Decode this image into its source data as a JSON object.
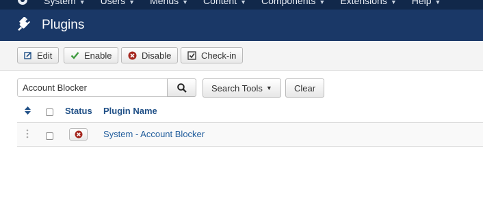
{
  "top_nav": {
    "items": [
      {
        "label": "System"
      },
      {
        "label": "Users"
      },
      {
        "label": "Menus"
      },
      {
        "label": "Content"
      },
      {
        "label": "Components"
      },
      {
        "label": "Extensions"
      },
      {
        "label": "Help"
      }
    ]
  },
  "header": {
    "title": "Plugins"
  },
  "toolbar": {
    "edit_label": "Edit",
    "enable_label": "Enable",
    "disable_label": "Disable",
    "checkin_label": "Check-in"
  },
  "search": {
    "value": "Account Blocker",
    "search_tools_label": "Search Tools",
    "clear_label": "Clear"
  },
  "table": {
    "headers": {
      "status": "Status",
      "plugin_name": "Plugin Name"
    },
    "rows": [
      {
        "status": "disabled",
        "plugin_name": "System - Account Blocker"
      }
    ]
  },
  "colors": {
    "nav_bg": "#11284a",
    "header_bg": "#1a3867",
    "link": "#215d9c",
    "enable_green": "#3d9a3d",
    "disable_red": "#a5271f"
  }
}
